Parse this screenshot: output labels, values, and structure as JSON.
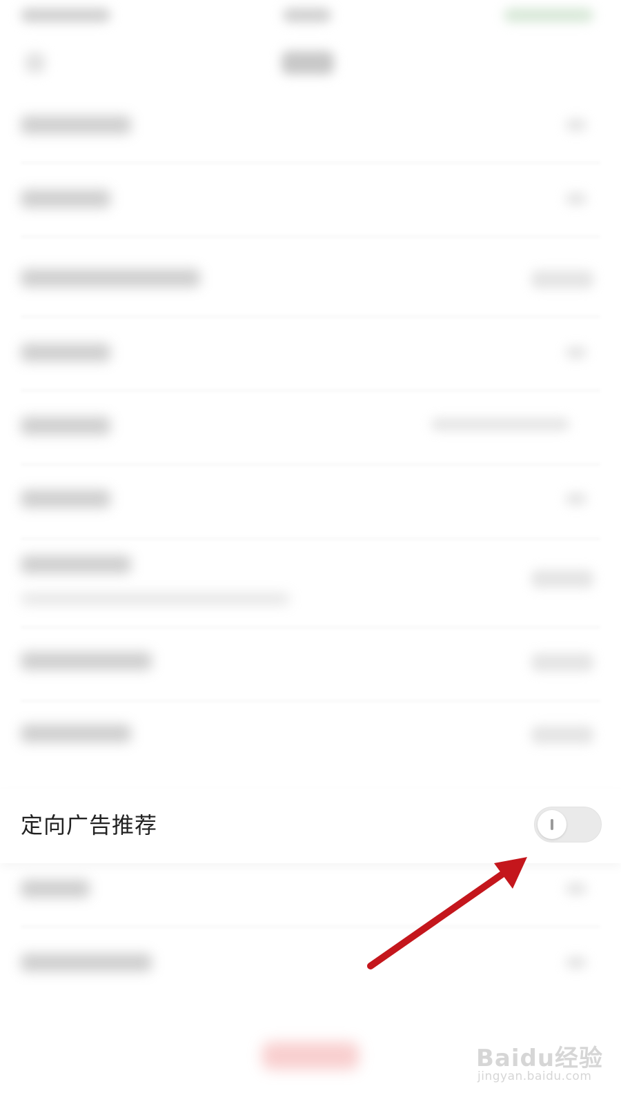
{
  "settings": {
    "focused_item": {
      "label": "定向广告推荐",
      "toggle_on": false
    }
  },
  "colors": {
    "arrow": "#c4161c",
    "toggle_track": "#eaeaea",
    "toggle_knob": "#ffffff"
  },
  "watermark": {
    "logo": "Baidu经验",
    "url": "jingyan.baidu.com"
  }
}
